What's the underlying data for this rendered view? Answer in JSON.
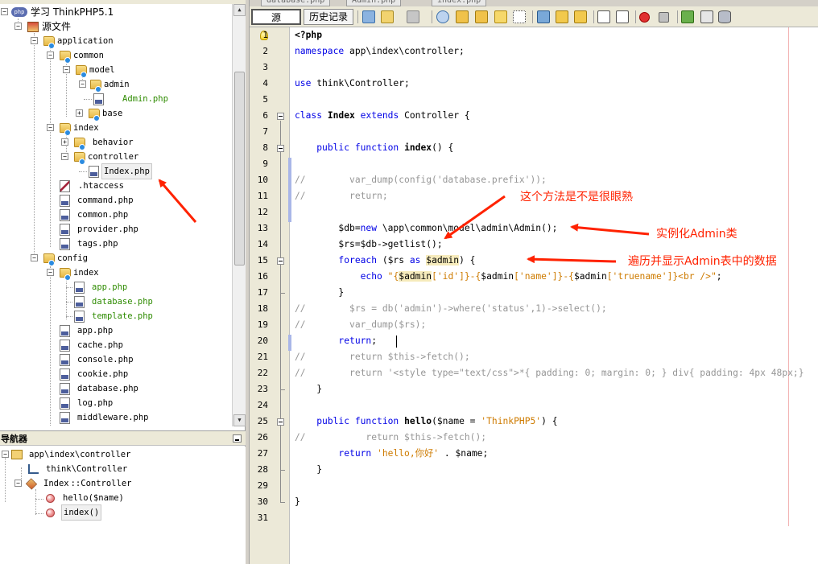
{
  "project_tree": {
    "nodes": [
      {
        "label": "学习 ThinkPHP5.1"
      },
      {
        "label": "源文件"
      },
      {
        "label": "application"
      },
      {
        "label": "common"
      },
      {
        "label": "model"
      },
      {
        "label": "admin"
      },
      {
        "label": "Admin.php"
      },
      {
        "label": "base"
      },
      {
        "label": "index"
      },
      {
        "label": "behavior"
      },
      {
        "label": "controller"
      },
      {
        "label": "Index.php"
      },
      {
        "label": ".htaccess"
      },
      {
        "label": "command.php"
      },
      {
        "label": "common.php"
      },
      {
        "label": "provider.php"
      },
      {
        "label": "tags.php"
      },
      {
        "label": "config"
      },
      {
        "label": "index"
      },
      {
        "label": "app.php"
      },
      {
        "label": "database.php"
      },
      {
        "label": "template.php"
      },
      {
        "label": "app.php"
      },
      {
        "label": "cache.php"
      },
      {
        "label": "console.php"
      },
      {
        "label": "cookie.php"
      },
      {
        "label": "database.php"
      },
      {
        "label": "log.php"
      },
      {
        "label": "middleware.php"
      }
    ]
  },
  "navigator": {
    "title": "导航器",
    "items": [
      {
        "label": "app\\index\\controller"
      },
      {
        "label": "think\\Controller"
      },
      {
        "label": "Index",
        "suffix": "::Controller"
      },
      {
        "label": "hello($name)"
      },
      {
        "label": "index()"
      }
    ]
  },
  "editor": {
    "tabs": [
      "database.php",
      "Admin.php",
      "index.php"
    ],
    "toolbar": {
      "source_label": "源",
      "history_label": "历史记录"
    },
    "line_numbers": [
      "1",
      "2",
      "3",
      "4",
      "5",
      "6",
      "7",
      "8",
      "9",
      "10",
      "11",
      "12",
      "13",
      "14",
      "15",
      "16",
      "17",
      "18",
      "19",
      "20",
      "21",
      "22",
      "23",
      "24",
      "25",
      "26",
      "27",
      "28",
      "29",
      "30",
      "31"
    ]
  },
  "annotations": {
    "a1": "这个方法是不是很眼熟",
    "a2": "实例化Admin类",
    "a3": "遍历并显示Admin表中的数据"
  },
  "colors": {
    "keyword": "#0000e6",
    "comment": "#969696",
    "string": "#ce7b00",
    "annotation": "#ff2200"
  }
}
